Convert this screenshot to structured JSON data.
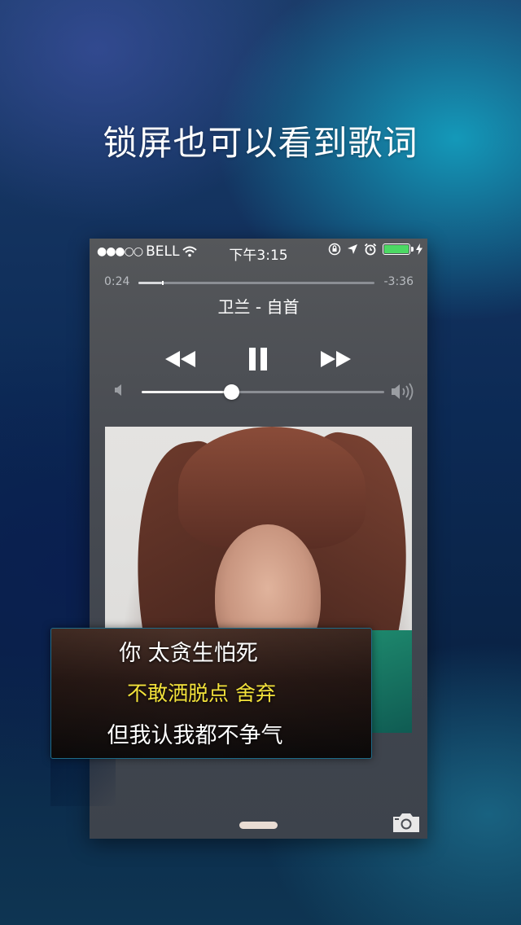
{
  "headline": "锁屏也可以看到歌词",
  "status_bar": {
    "signal": "●●●○○",
    "carrier": "BELL",
    "time": "下午3:15",
    "battery_color": "#4cd964",
    "battery_level": 1.0
  },
  "player": {
    "elapsed": "0:24",
    "remaining": "-3:36",
    "progress": 0.1,
    "song_title": "卫兰 - 自首",
    "volume": 0.37,
    "controls": {
      "prev_icon": "rewind-icon",
      "pause_icon": "pause-icon",
      "next_icon": "fast-forward-icon"
    }
  },
  "lyrics": {
    "line1": "你 太贪生怕死",
    "line2": "不敢洒脱点 舍弃",
    "line3": "但我认我都不争气",
    "highlight_color": "#f4e33b"
  }
}
